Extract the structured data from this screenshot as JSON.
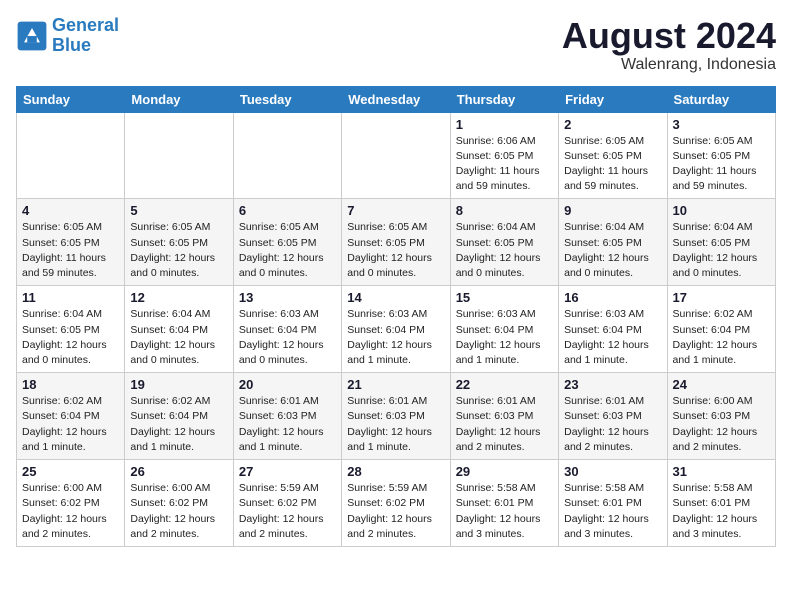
{
  "header": {
    "logo_line1": "General",
    "logo_line2": "Blue",
    "month": "August 2024",
    "location": "Walenrang, Indonesia"
  },
  "weekdays": [
    "Sunday",
    "Monday",
    "Tuesday",
    "Wednesday",
    "Thursday",
    "Friday",
    "Saturday"
  ],
  "weeks": [
    [
      {
        "day": "",
        "info": ""
      },
      {
        "day": "",
        "info": ""
      },
      {
        "day": "",
        "info": ""
      },
      {
        "day": "",
        "info": ""
      },
      {
        "day": "1",
        "info": "Sunrise: 6:06 AM\nSunset: 6:05 PM\nDaylight: 11 hours\nand 59 minutes."
      },
      {
        "day": "2",
        "info": "Sunrise: 6:05 AM\nSunset: 6:05 PM\nDaylight: 11 hours\nand 59 minutes."
      },
      {
        "day": "3",
        "info": "Sunrise: 6:05 AM\nSunset: 6:05 PM\nDaylight: 11 hours\nand 59 minutes."
      }
    ],
    [
      {
        "day": "4",
        "info": "Sunrise: 6:05 AM\nSunset: 6:05 PM\nDaylight: 11 hours\nand 59 minutes."
      },
      {
        "day": "5",
        "info": "Sunrise: 6:05 AM\nSunset: 6:05 PM\nDaylight: 12 hours\nand 0 minutes."
      },
      {
        "day": "6",
        "info": "Sunrise: 6:05 AM\nSunset: 6:05 PM\nDaylight: 12 hours\nand 0 minutes."
      },
      {
        "day": "7",
        "info": "Sunrise: 6:05 AM\nSunset: 6:05 PM\nDaylight: 12 hours\nand 0 minutes."
      },
      {
        "day": "8",
        "info": "Sunrise: 6:04 AM\nSunset: 6:05 PM\nDaylight: 12 hours\nand 0 minutes."
      },
      {
        "day": "9",
        "info": "Sunrise: 6:04 AM\nSunset: 6:05 PM\nDaylight: 12 hours\nand 0 minutes."
      },
      {
        "day": "10",
        "info": "Sunrise: 6:04 AM\nSunset: 6:05 PM\nDaylight: 12 hours\nand 0 minutes."
      }
    ],
    [
      {
        "day": "11",
        "info": "Sunrise: 6:04 AM\nSunset: 6:05 PM\nDaylight: 12 hours\nand 0 minutes."
      },
      {
        "day": "12",
        "info": "Sunrise: 6:04 AM\nSunset: 6:04 PM\nDaylight: 12 hours\nand 0 minutes."
      },
      {
        "day": "13",
        "info": "Sunrise: 6:03 AM\nSunset: 6:04 PM\nDaylight: 12 hours\nand 0 minutes."
      },
      {
        "day": "14",
        "info": "Sunrise: 6:03 AM\nSunset: 6:04 PM\nDaylight: 12 hours\nand 1 minute."
      },
      {
        "day": "15",
        "info": "Sunrise: 6:03 AM\nSunset: 6:04 PM\nDaylight: 12 hours\nand 1 minute."
      },
      {
        "day": "16",
        "info": "Sunrise: 6:03 AM\nSunset: 6:04 PM\nDaylight: 12 hours\nand 1 minute."
      },
      {
        "day": "17",
        "info": "Sunrise: 6:02 AM\nSunset: 6:04 PM\nDaylight: 12 hours\nand 1 minute."
      }
    ],
    [
      {
        "day": "18",
        "info": "Sunrise: 6:02 AM\nSunset: 6:04 PM\nDaylight: 12 hours\nand 1 minute."
      },
      {
        "day": "19",
        "info": "Sunrise: 6:02 AM\nSunset: 6:04 PM\nDaylight: 12 hours\nand 1 minute."
      },
      {
        "day": "20",
        "info": "Sunrise: 6:01 AM\nSunset: 6:03 PM\nDaylight: 12 hours\nand 1 minute."
      },
      {
        "day": "21",
        "info": "Sunrise: 6:01 AM\nSunset: 6:03 PM\nDaylight: 12 hours\nand 1 minute."
      },
      {
        "day": "22",
        "info": "Sunrise: 6:01 AM\nSunset: 6:03 PM\nDaylight: 12 hours\nand 2 minutes."
      },
      {
        "day": "23",
        "info": "Sunrise: 6:01 AM\nSunset: 6:03 PM\nDaylight: 12 hours\nand 2 minutes."
      },
      {
        "day": "24",
        "info": "Sunrise: 6:00 AM\nSunset: 6:03 PM\nDaylight: 12 hours\nand 2 minutes."
      }
    ],
    [
      {
        "day": "25",
        "info": "Sunrise: 6:00 AM\nSunset: 6:02 PM\nDaylight: 12 hours\nand 2 minutes."
      },
      {
        "day": "26",
        "info": "Sunrise: 6:00 AM\nSunset: 6:02 PM\nDaylight: 12 hours\nand 2 minutes."
      },
      {
        "day": "27",
        "info": "Sunrise: 5:59 AM\nSunset: 6:02 PM\nDaylight: 12 hours\nand 2 minutes."
      },
      {
        "day": "28",
        "info": "Sunrise: 5:59 AM\nSunset: 6:02 PM\nDaylight: 12 hours\nand 2 minutes."
      },
      {
        "day": "29",
        "info": "Sunrise: 5:58 AM\nSunset: 6:01 PM\nDaylight: 12 hours\nand 3 minutes."
      },
      {
        "day": "30",
        "info": "Sunrise: 5:58 AM\nSunset: 6:01 PM\nDaylight: 12 hours\nand 3 minutes."
      },
      {
        "day": "31",
        "info": "Sunrise: 5:58 AM\nSunset: 6:01 PM\nDaylight: 12 hours\nand 3 minutes."
      }
    ]
  ]
}
